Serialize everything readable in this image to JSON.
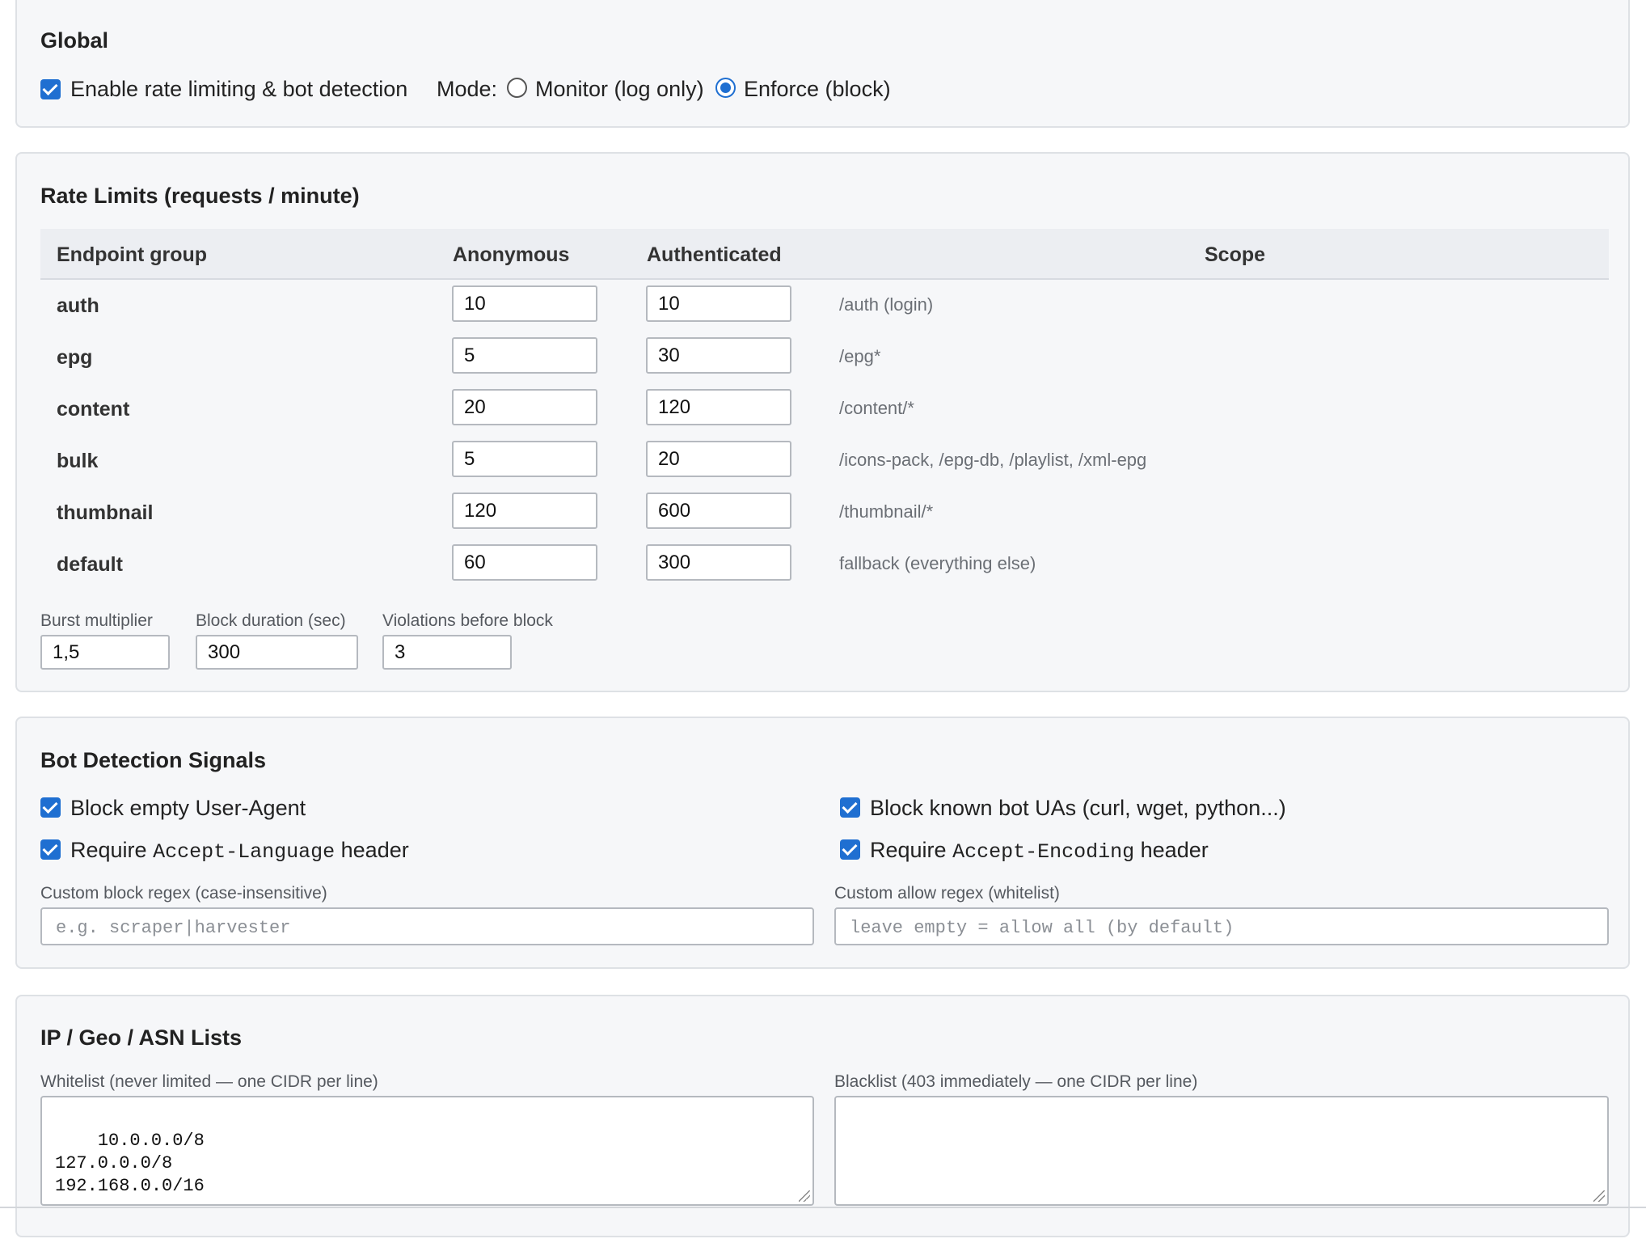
{
  "global": {
    "title": "Global",
    "enable_label": "Enable rate limiting & bot detection",
    "enable_checked": true,
    "mode_label": "Mode:",
    "mode_options": [
      "Monitor (log only)",
      "Enforce (block)"
    ],
    "mode_selected": "Enforce (block)"
  },
  "rate_limits": {
    "title": "Rate Limits (requests / minute)",
    "columns": [
      "Endpoint group",
      "Anonymous",
      "Authenticated",
      "Scope"
    ],
    "rows": [
      {
        "group": "auth",
        "anonymous": "10",
        "authenticated": "10",
        "scope": "/auth (login)"
      },
      {
        "group": "epg",
        "anonymous": "5",
        "authenticated": "30",
        "scope": "/epg*"
      },
      {
        "group": "content",
        "anonymous": "20",
        "authenticated": "120",
        "scope": "/content/*"
      },
      {
        "group": "bulk",
        "anonymous": "5",
        "authenticated": "20",
        "scope": "/icons-pack, /epg-db, /playlist, /xml-epg"
      },
      {
        "group": "thumbnail",
        "anonymous": "120",
        "authenticated": "600",
        "scope": "/thumbnail/*"
      },
      {
        "group": "default",
        "anonymous": "60",
        "authenticated": "300",
        "scope": "fallback (everything else)"
      }
    ],
    "burst_label": "Burst multiplier",
    "burst_value": "1,5",
    "block_duration_label": "Block duration (sec)",
    "block_duration_value": "300",
    "violations_label": "Violations before block",
    "violations_value": "3"
  },
  "bot_detection": {
    "title": "Bot Detection Signals",
    "block_empty_ua": "Block empty User-Agent",
    "block_known_bots": "Block known bot UAs (curl, wget, python...)",
    "require_word": "Require",
    "header_word": "header",
    "accept_language": "Accept-Language",
    "accept_encoding": "Accept-Encoding",
    "custom_block_label": "Custom block regex (case-insensitive)",
    "custom_block_placeholder": "e.g. scraper|harvester",
    "custom_allow_label": "Custom allow regex (whitelist)",
    "custom_allow_placeholder": "leave empty = allow all (by default)"
  },
  "ip_lists": {
    "title": "IP / Geo / ASN Lists",
    "whitelist_label": "Whitelist (never limited — one CIDR per line)",
    "whitelist_value": "10.0.0.0/8\n127.0.0.0/8\n192.168.0.0/16",
    "blacklist_label": "Blacklist (403 immediately — one CIDR per line)",
    "blacklist_value": ""
  },
  "colors": {
    "accent": "#1f6fd1",
    "card_bg": "#f6f7f9",
    "card_border": "#dee1e5"
  }
}
